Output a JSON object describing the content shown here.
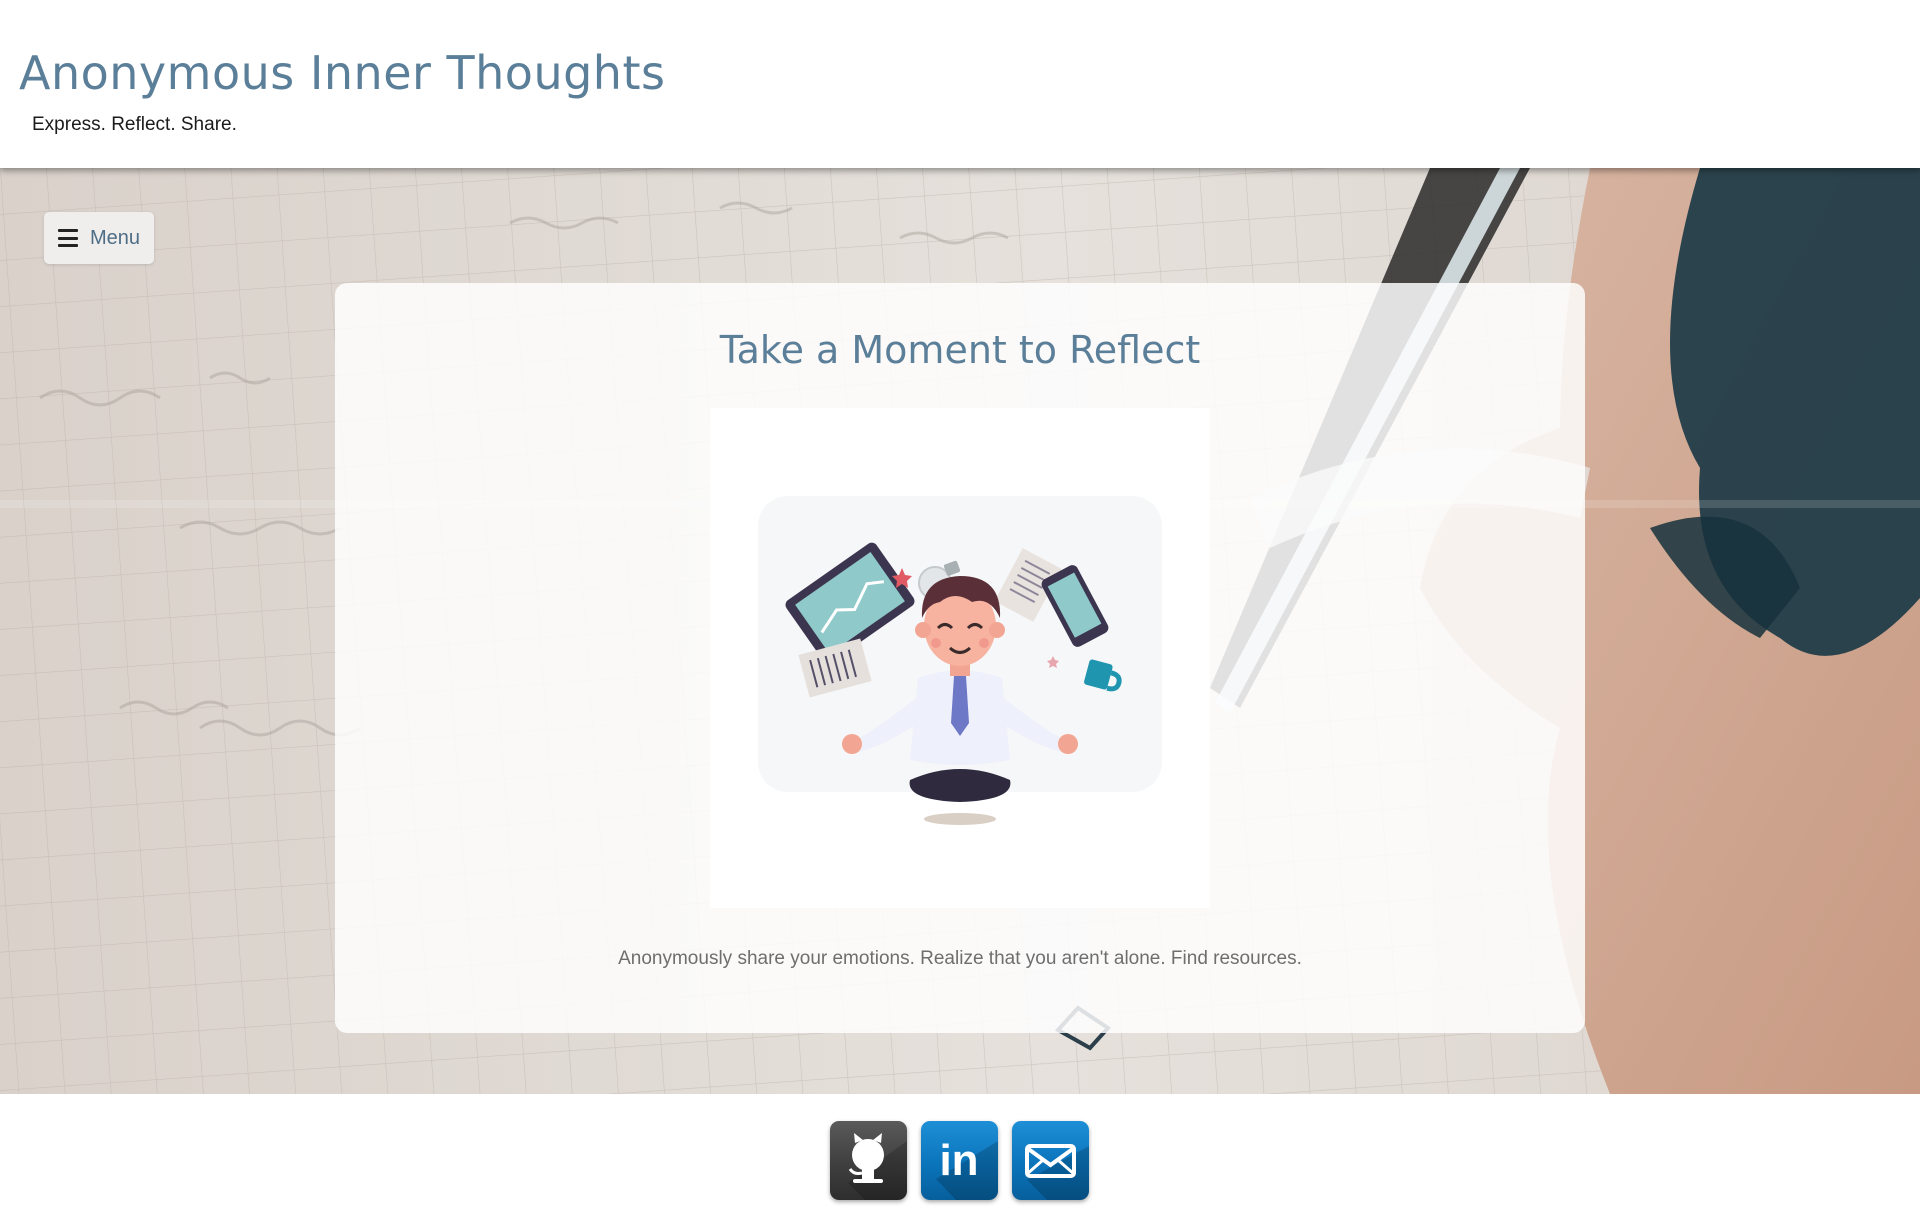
{
  "header": {
    "title": "Anonymous Inner Thoughts",
    "tagline": "Express. Reflect. Share."
  },
  "nav": {
    "menu_label": "Menu",
    "menu_icon": "hamburger-icon"
  },
  "hero": {
    "background": "notebook-and-hand-photo",
    "card": {
      "title": "Take a Moment to Reflect",
      "illustration": "meditating-person-illustration",
      "description": "Anonymously share your emotions. Realize that you aren't alone. Find resources."
    }
  },
  "footer": {
    "social": [
      {
        "name": "GitHub",
        "icon": "github-icon",
        "color": "#3f3f3f"
      },
      {
        "name": "LinkedIn",
        "icon": "linkedin-icon",
        "color": "#0a74bb",
        "glyph": "in"
      },
      {
        "name": "Email",
        "icon": "email-icon",
        "color": "#0a74bb"
      }
    ]
  },
  "colors": {
    "title": "#5b7f99",
    "menu_text": "#4f6e86",
    "body_text": "#6e6e6e"
  }
}
